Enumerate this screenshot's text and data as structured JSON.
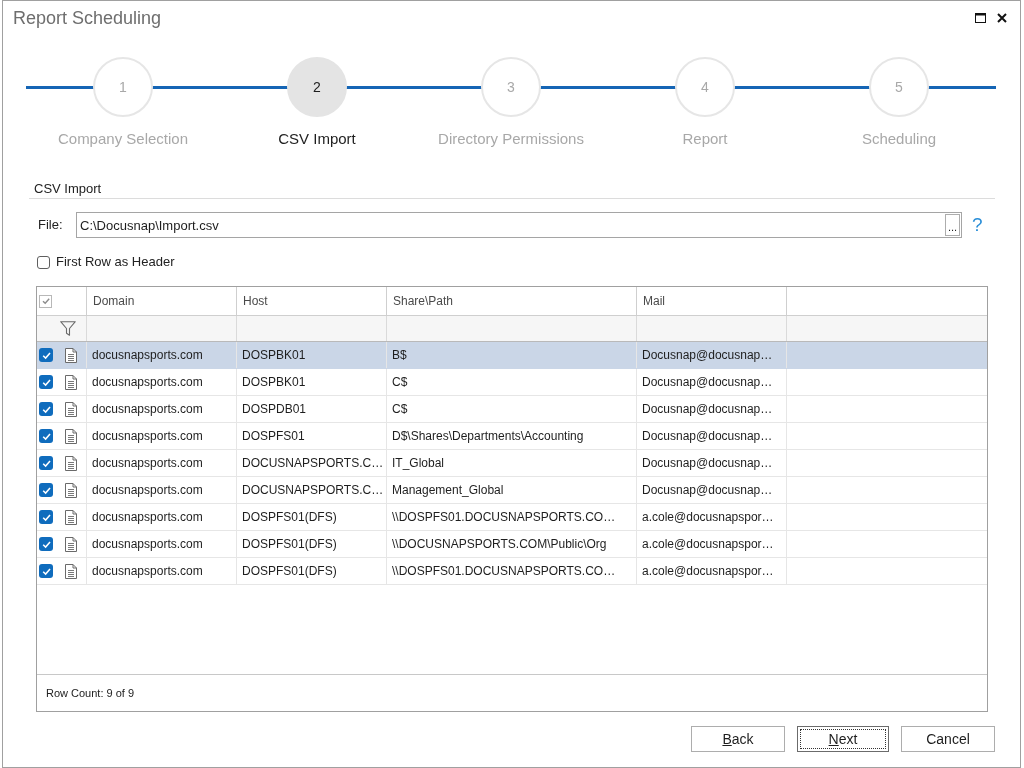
{
  "window": {
    "title": "Report Scheduling"
  },
  "steps": [
    {
      "number": "1",
      "label": "Company Selection",
      "selected": false
    },
    {
      "number": "2",
      "label": "CSV Import",
      "selected": true
    },
    {
      "number": "3",
      "label": "Directory Permissions",
      "selected": false
    },
    {
      "number": "4",
      "label": "Report",
      "selected": false
    },
    {
      "number": "5",
      "label": "Scheduling",
      "selected": false
    }
  ],
  "section": {
    "title": "CSV Import"
  },
  "file": {
    "label": "File:",
    "value": "C:\\Docusnap\\Import.csv",
    "browse": "...",
    "help": "?"
  },
  "first_row_as_header": {
    "label": "First Row as Header",
    "checked": false
  },
  "table": {
    "select_all_checked": true,
    "columns": [
      "Domain",
      "Host",
      "Share\\Path",
      "Mail"
    ],
    "rows": [
      {
        "checked": true,
        "selected": true,
        "cells": [
          "docusnapsports.com",
          "DOSPBK01",
          "B$",
          "Docusnap@docusnap…"
        ]
      },
      {
        "checked": true,
        "selected": false,
        "cells": [
          "docusnapsports.com",
          "DOSPBK01",
          "C$",
          "Docusnap@docusnap…"
        ]
      },
      {
        "checked": true,
        "selected": false,
        "cells": [
          "docusnapsports.com",
          "DOSPDB01",
          "C$",
          "Docusnap@docusnap…"
        ]
      },
      {
        "checked": true,
        "selected": false,
        "cells": [
          "docusnapsports.com",
          "DOSPFS01",
          "D$\\Shares\\Departments\\Accounting",
          "Docusnap@docusnap…"
        ]
      },
      {
        "checked": true,
        "selected": false,
        "cells": [
          "docusnapsports.com",
          "DOCUSNAPSPORTS.C…",
          "IT_Global",
          "Docusnap@docusnap…"
        ]
      },
      {
        "checked": true,
        "selected": false,
        "cells": [
          "docusnapsports.com",
          "DOCUSNAPSPORTS.C…",
          "Management_Global",
          "Docusnap@docusnap…"
        ]
      },
      {
        "checked": true,
        "selected": false,
        "cells": [
          "docusnapsports.com",
          "DOSPFS01(DFS)",
          "\\\\DOSPFS01.DOCUSNAPSPORTS.CO…",
          "a.cole@docusnapspor…"
        ]
      },
      {
        "checked": true,
        "selected": false,
        "cells": [
          "docusnapsports.com",
          "DOSPFS01(DFS)",
          "\\\\DOCUSNAPSPORTS.COM\\Public\\Org",
          "a.cole@docusnapspor…"
        ]
      },
      {
        "checked": true,
        "selected": false,
        "cells": [
          "docusnapsports.com",
          "DOSPFS01(DFS)",
          "\\\\DOSPFS01.DOCUSNAPSPORTS.CO…",
          "a.cole@docusnapspor…"
        ]
      }
    ],
    "row_count": "Row Count: 9 of 9"
  },
  "buttons": [
    {
      "access_key": "B",
      "rest": "ack",
      "focused": false
    },
    {
      "access_key": "N",
      "rest": "ext",
      "focused": true
    },
    {
      "label": "Cancel",
      "focused": false
    }
  ]
}
